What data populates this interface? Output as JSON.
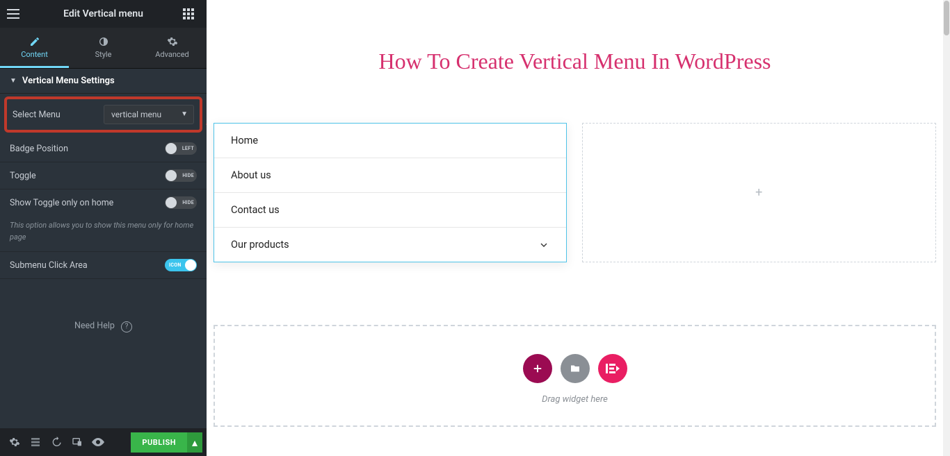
{
  "header": {
    "title": "Edit Vertical menu"
  },
  "tabs": {
    "content": "Content",
    "style": "Style",
    "advanced": "Advanced"
  },
  "section": {
    "title": "Vertical Menu Settings"
  },
  "controls": {
    "select_menu_label": "Select Menu",
    "select_menu_value": "vertical menu",
    "badge_position_label": "Badge Position",
    "badge_position_value": "LEFT",
    "toggle_label": "Toggle",
    "toggle_value": "HIDE",
    "show_toggle_home_label": "Show Toggle only on home",
    "show_toggle_home_value": "HIDE",
    "show_toggle_home_hint": "This option allows you to show this menu only for home page",
    "submenu_click_label": "Submenu Click Area",
    "submenu_click_value": "ICON"
  },
  "need_help": "Need Help",
  "publish": "PUBLISH",
  "page": {
    "title": "How To Create Vertical Menu In WordPress",
    "menu_items": [
      {
        "label": "Home",
        "has_children": false
      },
      {
        "label": "About us",
        "has_children": false
      },
      {
        "label": "Contact us",
        "has_children": false
      },
      {
        "label": "Our products",
        "has_children": true
      }
    ],
    "drop_label": "Drag widget here"
  }
}
